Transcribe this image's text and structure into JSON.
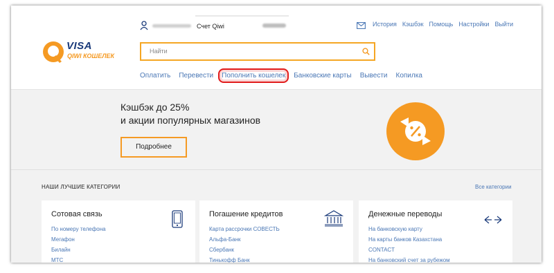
{
  "brand": {
    "visa": "VISA",
    "qiwi": "QIWI КОШЕЛЕК"
  },
  "topbar": {
    "account_label": "Счет Qiwi",
    "links": [
      "История",
      "Кэшбэк",
      "Помощь",
      "Настройки",
      "Выйти"
    ]
  },
  "search": {
    "placeholder": "Найти"
  },
  "nav": {
    "items": [
      "Оплатить",
      "Перевести",
      "Пополнить кошелек",
      "Банковские карты",
      "Вывести",
      "Копилка"
    ],
    "highlighted": "Пополнить кошелек"
  },
  "promo": {
    "line1": "Кэшбэк до 25%",
    "line2": "и акции популярных магазинов",
    "button": "Подробнее"
  },
  "categories": {
    "title": "НАШИ ЛУЧШИЕ КАТЕГОРИИ",
    "all_link": "Все категории",
    "cards": [
      {
        "title": "Сотовая связь",
        "icon": "phone-icon",
        "items": [
          "По номеру телефона",
          "Мегафон",
          "Билайн",
          "МТС"
        ]
      },
      {
        "title": "Погашение кредитов",
        "icon": "bank-icon",
        "items": [
          "Карта рассрочки СОВЕСТЬ",
          "Альфа-Банк",
          "Сбербанк",
          "Тинькофф Банк"
        ]
      },
      {
        "title": "Денежные переводы",
        "icon": "transfer-arrows-icon",
        "items": [
          "На банковскую карту",
          "На карты банков Казахстана",
          "CONTACT",
          "На банковский счет за рубежом"
        ]
      }
    ]
  },
  "colors": {
    "accent": "#f59a23",
    "link": "#4a77b5",
    "highlight": "#e11b1b",
    "background": "#f2f2f2"
  }
}
